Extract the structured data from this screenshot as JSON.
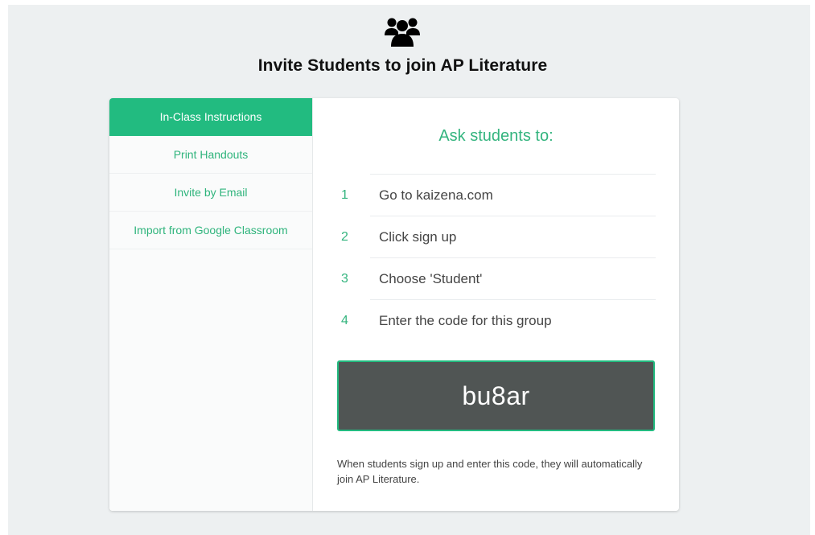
{
  "header": {
    "icon": "group-icon",
    "title": "Invite Students to join AP Literature"
  },
  "sidebar": {
    "items": [
      {
        "label": "In-Class Instructions",
        "active": true
      },
      {
        "label": "Print Handouts",
        "active": false
      },
      {
        "label": "Invite by Email",
        "active": false
      },
      {
        "label": "Import from Google Classroom",
        "active": false
      }
    ]
  },
  "main": {
    "heading": "Ask students to:",
    "steps": [
      {
        "number": "1",
        "text": "Go to kaizena.com"
      },
      {
        "number": "2",
        "text": "Click sign up"
      },
      {
        "number": "3",
        "text": "Choose 'Student'"
      },
      {
        "number": "4",
        "text": "Enter the code for this group"
      }
    ],
    "group_code": "bu8ar",
    "footnote": "When students sign up and enter this code, they will automatically join AP Literature."
  },
  "colors": {
    "accent": "#22bb80",
    "accent_text": "#33b47e",
    "code_background": "#505554",
    "page_background": "#edf0f1"
  }
}
